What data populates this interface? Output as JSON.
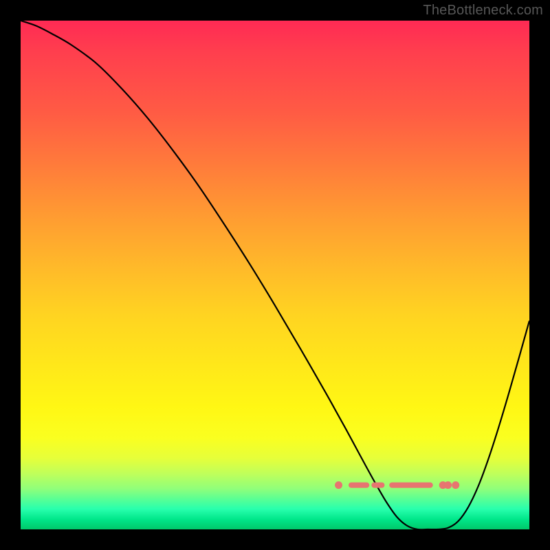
{
  "watermark": "TheBottleneck.com",
  "colors": {
    "curve": "#000000",
    "marker": "#e77570"
  },
  "chart_data": {
    "type": "line",
    "title": "",
    "xlabel": "",
    "ylabel": "",
    "xlim": [
      0,
      100
    ],
    "ylim": [
      0,
      100
    ],
    "grid": false,
    "x": [
      0,
      3,
      6,
      10,
      15,
      20,
      25,
      30,
      35,
      40,
      45,
      50,
      55,
      60,
      62,
      64,
      66,
      68,
      70,
      72,
      74,
      76,
      78,
      80,
      82,
      84,
      86,
      88,
      90,
      92,
      94,
      96,
      98,
      100
    ],
    "values": [
      100,
      99,
      97.5,
      95.2,
      91.5,
      86.5,
      80.8,
      74.4,
      67.5,
      60.0,
      52.2,
      44.0,
      35.5,
      26.8,
      23.2,
      19.6,
      15.9,
      12.2,
      8.6,
      5.2,
      2.4,
      0.7,
      0.0,
      0.0,
      0.0,
      0.3,
      1.6,
      4.4,
      8.6,
      14.0,
      20.2,
      26.9,
      33.9,
      41.0
    ],
    "min_region_x": [
      62,
      86
    ],
    "markers": {
      "dots_x": [
        62.5,
        83.0,
        84.0,
        85.5
      ],
      "segments": [
        {
          "x0": 65.0,
          "x1": 68.0
        },
        {
          "x0": 69.5,
          "x1": 71.0
        },
        {
          "x0": 73.0,
          "x1": 80.5
        }
      ],
      "y_screen_norm": 0.913
    }
  }
}
